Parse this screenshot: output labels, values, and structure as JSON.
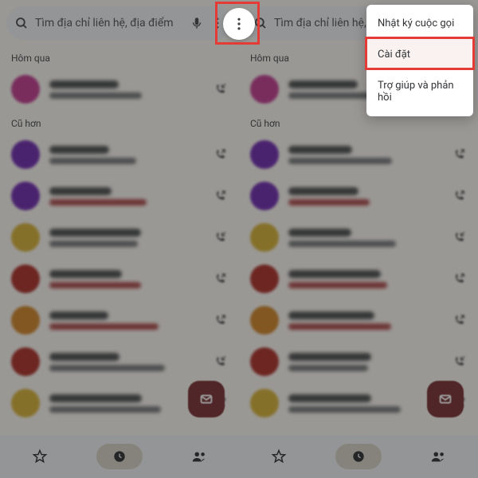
{
  "search_placeholder": "Tìm địa chỉ liên hệ, địa điểm",
  "sections": {
    "yesterday": "Hôm qua",
    "older": "Cũ hơn"
  },
  "menu": {
    "history": "Nhật ký cuộc gọi",
    "settings": "Cài đặt",
    "help": "Trợ giúp và phản hồi"
  },
  "avatar_colors": [
    "#d941a0",
    "#8233cc",
    "#8233cc",
    "#e0b528",
    "#c7372e",
    "#e08a1f",
    "#c7372e",
    "#e0b528"
  ]
}
